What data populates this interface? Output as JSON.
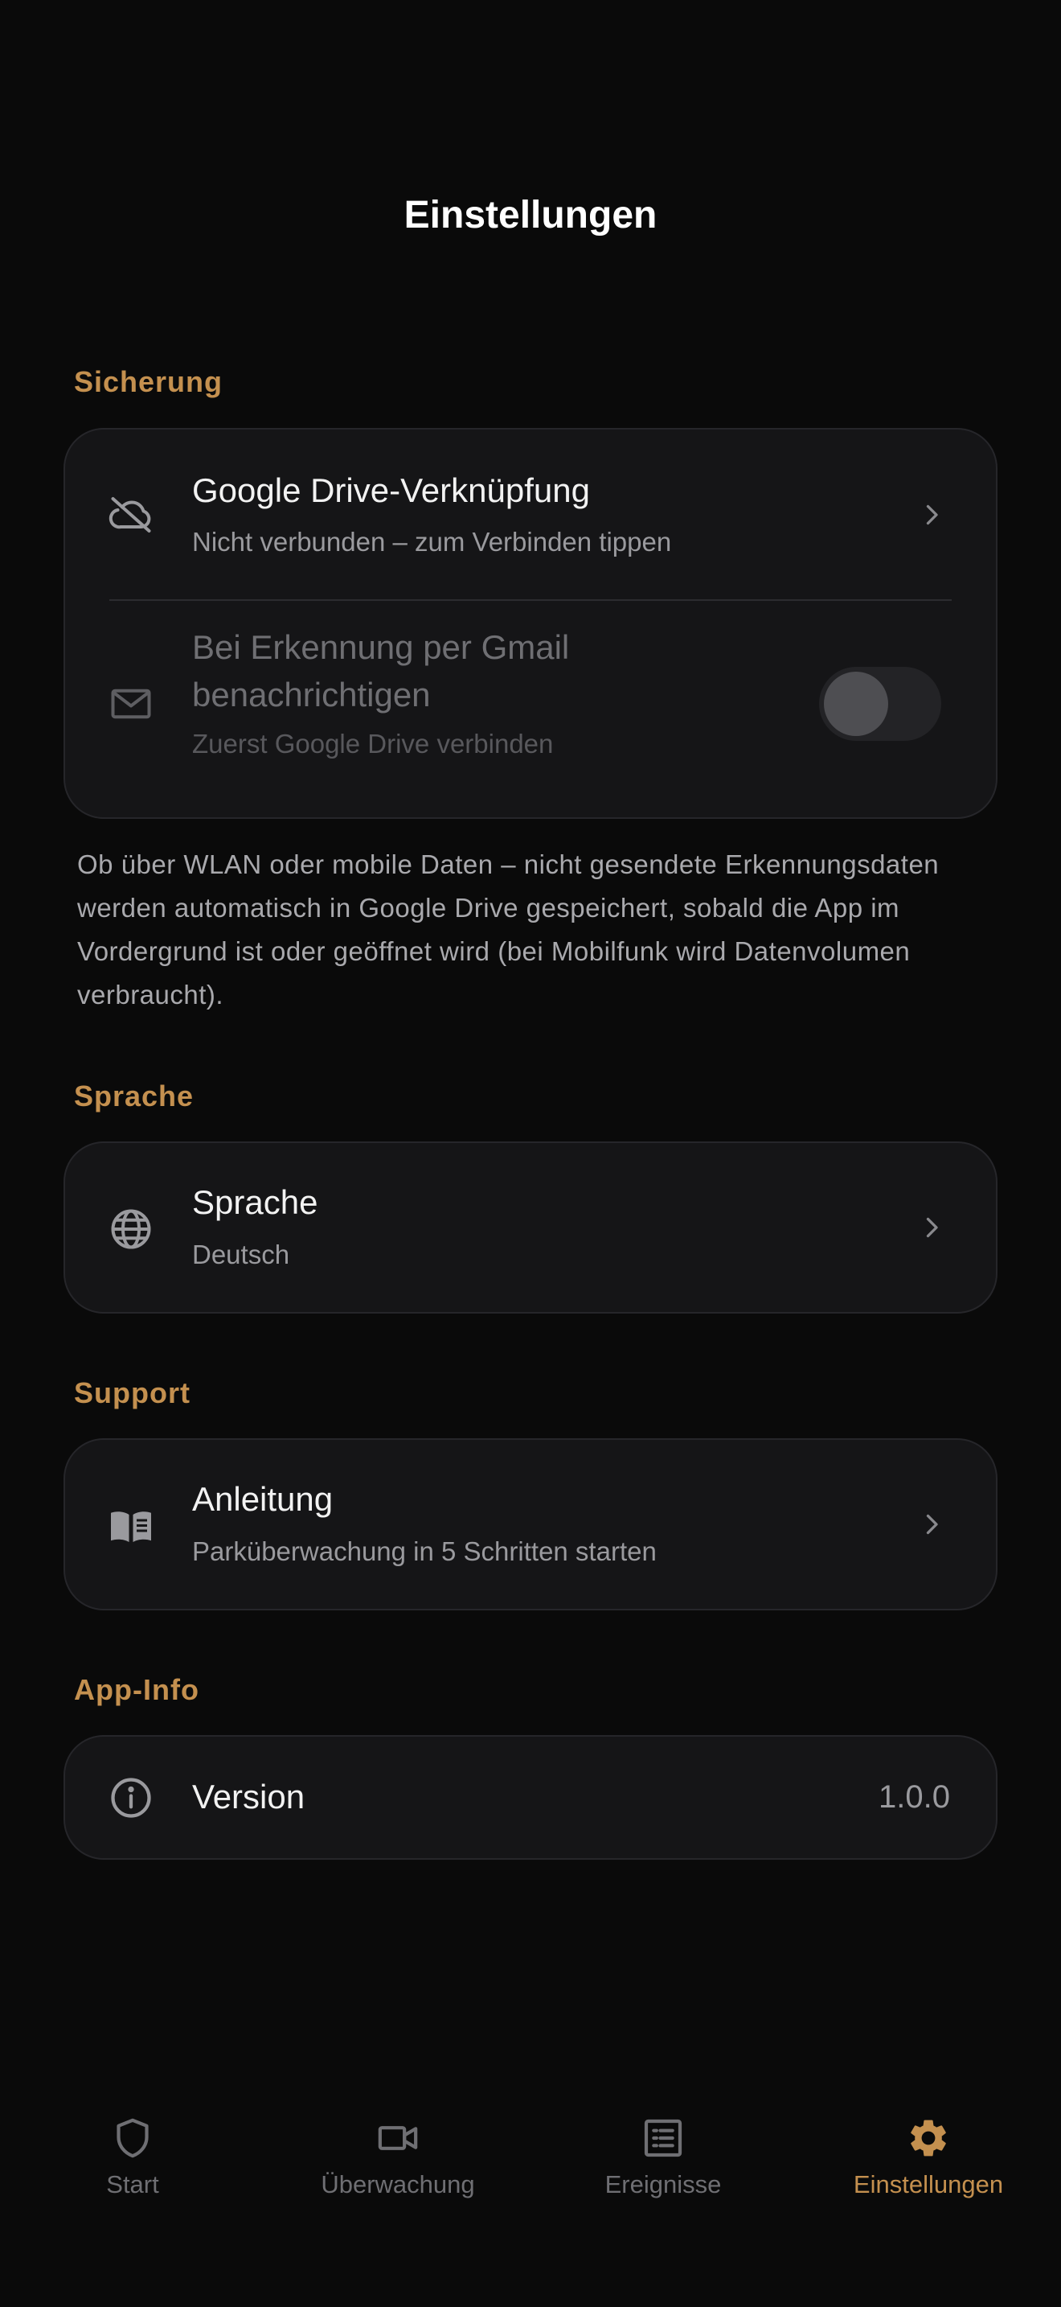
{
  "page": {
    "title": "Einstellungen"
  },
  "colors": {
    "background": "#0a0a0a",
    "card": "#151517",
    "accent": "#c4904f",
    "text": "#f2f2f2",
    "muted": "#9a9a9e"
  },
  "sections": {
    "backup": {
      "label": "Sicherung",
      "drive": {
        "icon": "cloud-off-icon",
        "title": "Google Drive-Verknüpfung",
        "subtitle": "Nicht verbunden – zum Verbinden tippen"
      },
      "gmail": {
        "icon": "mail-icon",
        "title_line1": "Bei Erkennung per Gmail",
        "title_line2": "benachrichtigen",
        "subtitle": "Zuerst Google Drive verbinden",
        "toggle_on": false,
        "enabled": false
      },
      "note": "Ob über WLAN oder mobile Daten – nicht gesendete Erkennungsdaten werden automatisch in Google Drive gespeichert, sobald die App im Vordergrund ist oder geöffnet wird (bei Mobilfunk wird Datenvolumen verbraucht)."
    },
    "language": {
      "label": "Sprache",
      "row": {
        "icon": "globe-icon",
        "title": "Sprache",
        "subtitle": "Deutsch"
      }
    },
    "support": {
      "label": "Support",
      "row": {
        "icon": "book-icon",
        "title": "Anleitung",
        "subtitle": "Parküberwachung in 5 Schritten starten"
      }
    },
    "app_info": {
      "label": "App-Info",
      "row": {
        "icon": "info-icon",
        "title": "Version",
        "value": "1.0.0"
      }
    }
  },
  "tabbar": {
    "active": "Einstellungen",
    "tabs": [
      {
        "label": "Start",
        "icon": "shield-icon"
      },
      {
        "label": "Überwachung",
        "icon": "video-camera-icon"
      },
      {
        "label": "Ereignisse",
        "icon": "list-icon"
      },
      {
        "label": "Einstellungen",
        "icon": "gear-icon"
      }
    ]
  }
}
